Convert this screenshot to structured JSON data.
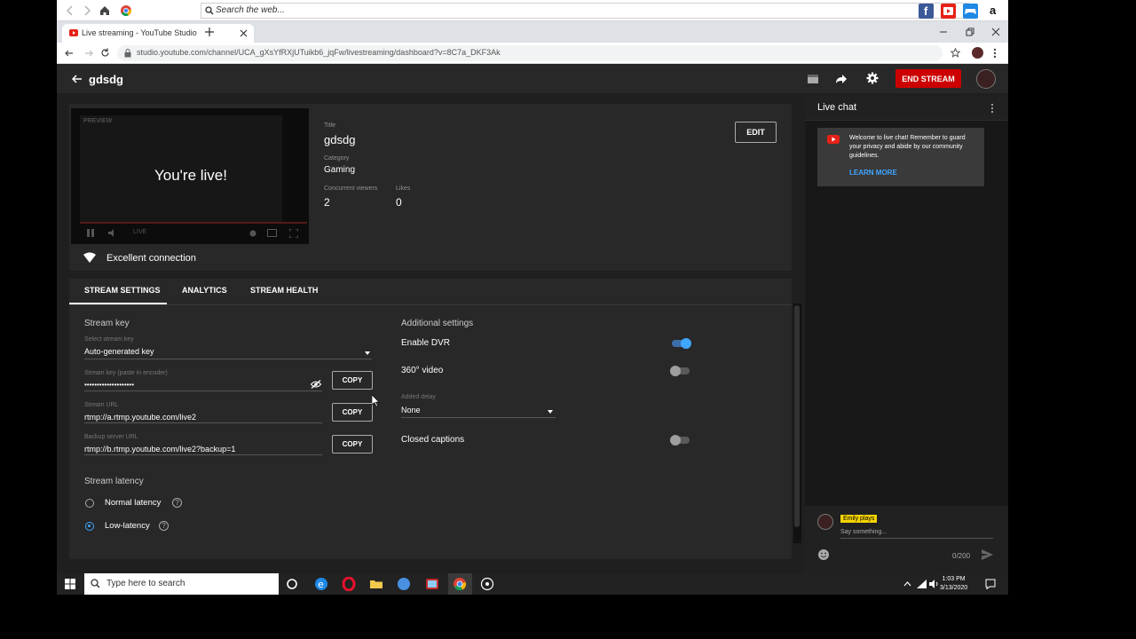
{
  "toolbar": {
    "search_placeholder": "Search the web..."
  },
  "browser": {
    "tab_title": "Live streaming - YouTube Studio",
    "url": "studio.youtube.com/channel/UCA_gXsYfRXjUTuikb6_jqFw/livestreaming/dashboard?v=8C7a_DKF3Ak"
  },
  "studio": {
    "channel_title": "gdsdg",
    "end_stream_label": "END STREAM",
    "preview_badge": "PREVIEW",
    "live_message": "You're live!",
    "live_badge": "LIVE",
    "meta": {
      "title_label": "Title",
      "title": "gdsdg",
      "category_label": "Category",
      "category": "Gaming",
      "viewers_label": "Concurrent viewers",
      "viewers": "2",
      "likes_label": "Likes",
      "likes": "0"
    },
    "edit_label": "EDIT",
    "connection": "Excellent connection",
    "tabs": [
      "STREAM SETTINGS",
      "ANALYTICS",
      "STREAM HEALTH"
    ],
    "stream_key": {
      "section_title": "Stream key",
      "select_label": "Select stream key",
      "select_value": "Auto-generated key",
      "key_label": "Stream key (paste in encoder)",
      "key_value": "••••••••••••••••••••",
      "url_label": "Stream URL",
      "url_value": "rtmp://a.rtmp.youtube.com/live2",
      "backup_label": "Backup server URL",
      "backup_value": "rtmp://b.rtmp.youtube.com/live2?backup=1",
      "copy_label": "COPY"
    },
    "latency": {
      "section_title": "Stream latency",
      "normal": "Normal latency",
      "low": "Low-latency",
      "selected": "low"
    },
    "additional": {
      "section_title": "Additional settings",
      "dvr_label": "Enable DVR",
      "dvr_on": true,
      "video360_label": "360° video",
      "video360_on": false,
      "delay_label": "Added delay",
      "delay_value": "None",
      "captions_label": "Closed captions",
      "captions_on": false
    }
  },
  "chat": {
    "title": "Live chat",
    "welcome": "Welcome to live chat! Remember to guard your privacy and abide by our community guidelines.",
    "learn_more": "LEARN MORE",
    "user_name": "Emily plays",
    "placeholder": "Say something...",
    "char_count": "0/200"
  },
  "taskbar": {
    "search_placeholder": "Type here to search",
    "time": "1:03 PM",
    "date": "3/13/2020"
  },
  "colors": {
    "end_stream": "#cc0000",
    "accent_blue": "#3ea6ff",
    "chat_user_badge": "#f5d400"
  }
}
